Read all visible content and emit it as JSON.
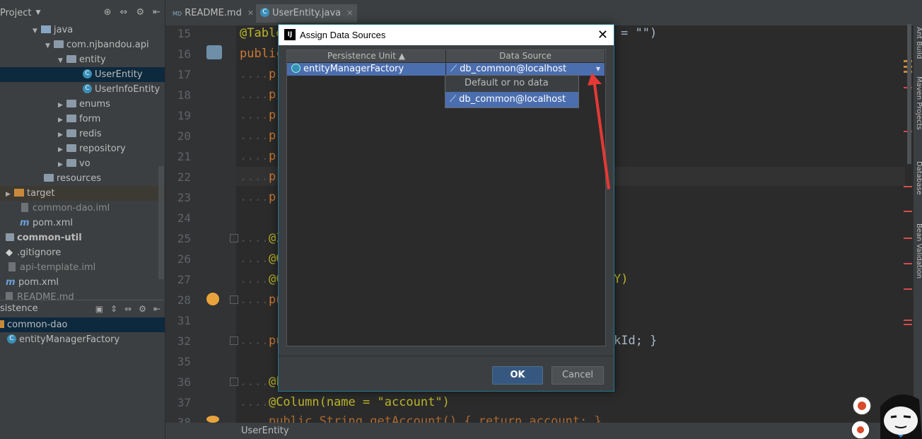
{
  "project_panel": {
    "title": "Project",
    "tree": [
      {
        "label": "java",
        "icon": "folder-blue"
      },
      {
        "label": "com.njbandou.api",
        "icon": "package"
      },
      {
        "label": "entity",
        "icon": "package"
      },
      {
        "label": "UserEntity",
        "icon": "class"
      },
      {
        "label": "UserInfoEntity",
        "icon": "class"
      },
      {
        "label": "enums",
        "icon": "package"
      },
      {
        "label": "form",
        "icon": "package"
      },
      {
        "label": "redis",
        "icon": "package"
      },
      {
        "label": "repository",
        "icon": "package"
      },
      {
        "label": "vo",
        "icon": "package"
      },
      {
        "label": "resources",
        "icon": "folder"
      },
      {
        "label": "target",
        "icon": "folder-orange"
      },
      {
        "label": "common-dao.iml",
        "icon": "iml"
      },
      {
        "label": "pom.xml",
        "icon": "maven"
      },
      {
        "label": "common-util",
        "icon": "module"
      },
      {
        "label": ".gitignore",
        "icon": "git"
      },
      {
        "label": "api-template.iml",
        "icon": "iml"
      },
      {
        "label": "pom.xml",
        "icon": "maven"
      },
      {
        "label": "README.md",
        "icon": "md"
      }
    ]
  },
  "persistence_panel": {
    "title": "sistence",
    "items": [
      {
        "label": "common-dao"
      },
      {
        "label": "entityManagerFactory"
      }
    ]
  },
  "tabs": [
    {
      "label": "README.md"
    },
    {
      "label": "UserEntity.java"
    }
  ],
  "editor": {
    "lines": [
      {
        "num": "15",
        "text": "@Table"
      },
      {
        "num": "16",
        "text": "public"
      },
      {
        "num": "17",
        "text": "pr"
      },
      {
        "num": "18",
        "text": "pr"
      },
      {
        "num": "19",
        "text": "pr"
      },
      {
        "num": "20",
        "text": "pr"
      },
      {
        "num": "21",
        "text": "pr"
      },
      {
        "num": "22",
        "text": "pr"
      },
      {
        "num": "23",
        "text": "pr"
      },
      {
        "num": "24",
        "text": ""
      },
      {
        "num": "25",
        "text": "@I"
      },
      {
        "num": "26",
        "text": "@G"
      },
      {
        "num": "27",
        "text": "@C"
      },
      {
        "num": "28",
        "text": "pu"
      },
      {
        "num": "31",
        "text": ""
      },
      {
        "num": "32",
        "text": "pu"
      },
      {
        "num": "35",
        "text": ""
      },
      {
        "num": "36",
        "text": "@E"
      },
      {
        "num": "37",
        "text": "@Column(name = \"account\")"
      },
      {
        "num": "38",
        "text": "public String getAccount() { return account; }"
      }
    ],
    "right_fragments": {
      "line15": "= \"\")",
      "line27": "Y)",
      "line32": "kId; }"
    },
    "status_tab": "UserEntity"
  },
  "right_toolbar": [
    "Ant Build",
    "Maven Projects",
    "Database",
    "Bean Validation"
  ],
  "dialog": {
    "title": "Assign Data Sources",
    "logo": "IJ",
    "columns": [
      "Persistence Unit ▲",
      "Data Source"
    ],
    "row": {
      "unit": "entityManagerFactory",
      "source": "db_common@localhost"
    },
    "dropdown_options": [
      "Default or no data source",
      "db_common@localhost"
    ],
    "selected_option": "db_common@localhost",
    "ok_label": "OK",
    "cancel_label": "Cancel"
  }
}
